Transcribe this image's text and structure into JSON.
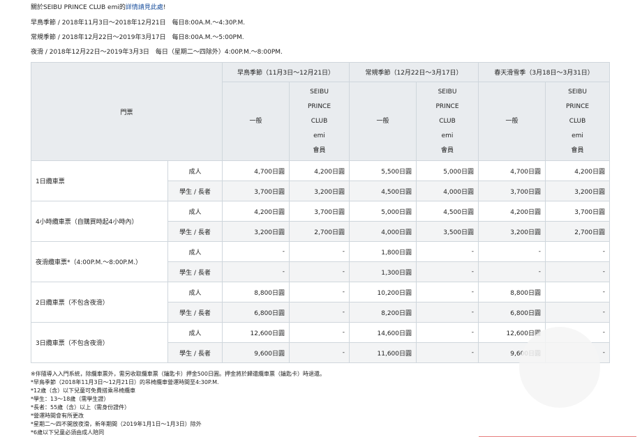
{
  "info": {
    "link_prefix": "關於SEIBU PRINCE CLUB emi的",
    "link_text": "詳情請見此處",
    "link_suffix": "!",
    "line1": "早鳥季節 / 2018年11月3日～2018年12月21日　每日8:00A.M.～4:30P.M.",
    "line2": "常規季節 / 2018年12月22日～2019年3月17日　每日8:00A.M.～5:00PM.",
    "line3": "夜滑 / 2018年12月22日～2019年3月3日　每日（星期二～四除外）4:00P.M.～8:00PM."
  },
  "table": {
    "ticket_header": "門票",
    "seasons": [
      "早鳥季節（11月3日～12月21日）",
      "常規季節（12月22日～3月17日）",
      "春天滑雪季（3月18日～3月31日）"
    ],
    "general": "一般",
    "member_lines": [
      "SEIBU",
      "PRINCE",
      "CLUB",
      "emi",
      "會員"
    ],
    "rows": [
      {
        "name": "1日纜車票",
        "adult": "成人",
        "student": "學生 / 長者",
        "adult_vals": [
          "4,700日圓",
          "4,200日圓",
          "5,500日圓",
          "5,000日圓",
          "4,700日圓",
          "4,200日圓"
        ],
        "student_vals": [
          "3,700日圓",
          "3,200日圓",
          "4,500日圓",
          "4,000日圓",
          "3,700日圓",
          "3,200日圓"
        ]
      },
      {
        "name": "4小時纜車票（自購買時起4小時內）",
        "adult": "成人",
        "student": "學生 / 長者",
        "adult_vals": [
          "4,200日圓",
          "3,700日圓",
          "5,000日圓",
          "4,500日圓",
          "4,200日圓",
          "3,700日圓"
        ],
        "student_vals": [
          "3,200日圓",
          "2,700日圓",
          "4,000日圓",
          "3,500日圓",
          "3,200日圓",
          "2,700日圓"
        ]
      },
      {
        "name": "夜滑纜車票*（4:00P.M.～8:00P.M.）",
        "adult": "成人",
        "student": "學生 / 長者",
        "adult_vals": [
          "-",
          "-",
          "1,800日圓",
          "-",
          "-",
          "-"
        ],
        "student_vals": [
          "-",
          "-",
          "1,300日圓",
          "-",
          "-",
          "-"
        ]
      },
      {
        "name": "2日纜車票（不包含夜滑）",
        "adult": "成人",
        "student": "學生 / 長者",
        "adult_vals": [
          "8,800日圓",
          "-",
          "10,200日圓",
          "-",
          "8,800日圓",
          "-"
        ],
        "student_vals": [
          "6,800日圓",
          "-",
          "8,200日圓",
          "-",
          "6,800日圓",
          "-"
        ]
      },
      {
        "name": "3日纜車票（不包含夜滑）",
        "adult": "成人",
        "student": "學生 / 長者",
        "adult_vals": [
          "12,600日圓",
          "-",
          "14,600日圓",
          "-",
          "12,600日圓",
          "-"
        ],
        "student_vals": [
          "9,600日圓",
          "-",
          "11,600日圓",
          "-",
          "9,600日圓",
          "-"
        ]
      }
    ]
  },
  "notes": [
    "※伴隨導入入門系統，除纜車票外，需另收取纜車票（鑰匙卡）押金500日圓。押金將於歸還纜車票（鑰匙卡）時退還。",
    "*早鳥季節（2018年11月3日～12月21日）的吊椅纜車營運時間至4:30P.M.",
    "*12歲（含）以下兒童可免費搭乘吊椅纜車",
    "*學生：13～18歲（需學生證）",
    "*長者：55歲（含）以上（需身份證件）",
    "*營運時間會有所更改",
    "*星期二～四不開放夜滑，新年期間（2019年1月1日～1月3日）除外",
    "*6歲以下兒童必須由成人陪同"
  ]
}
